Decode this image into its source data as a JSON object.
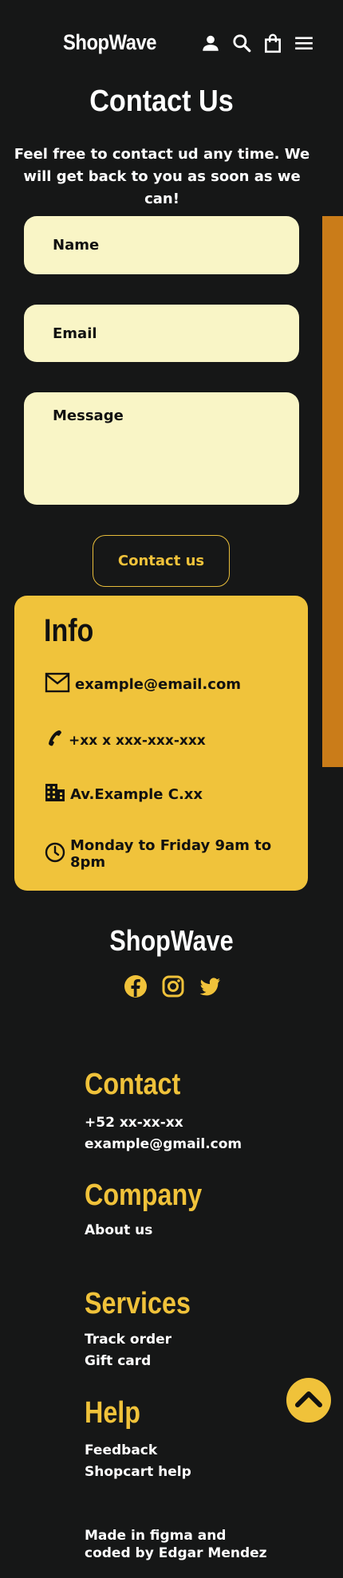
{
  "header": {
    "logo": "ShopWave",
    "icons": [
      "user-icon",
      "search-icon",
      "bag-icon",
      "menu-icon"
    ]
  },
  "page": {
    "title": "Contact Us",
    "intro": "Feel free to contact ud any time. We will get back to you as soon as we can!"
  },
  "form": {
    "name_placeholder": "Name",
    "email_placeholder": "Email",
    "message_placeholder": "Message",
    "submit_label": "Contact us"
  },
  "info": {
    "title": "Info",
    "email": "example@email.com",
    "phone": "+xx x xxx-xxx-xxx",
    "address": "Av.Example C.xx",
    "hours": "Monday to Friday 9am to 8pm"
  },
  "footer": {
    "logo": "ShopWave",
    "social": [
      "facebook-icon",
      "instagram-icon",
      "twitter-icon"
    ],
    "contact": {
      "title": "Contact",
      "phone": "+52 xx-xx-xx",
      "email": "example@gmail.com"
    },
    "company": {
      "title": "Company",
      "about": "About us"
    },
    "services": {
      "title": "Services",
      "track": "Track order",
      "gift": "Gift card"
    },
    "help": {
      "title": "Help",
      "feedback": "Feedback",
      "shopcart": "Shopcart help"
    },
    "credit_line1": "Made in figma and",
    "credit_line2": "coded by Edgar Mendez"
  },
  "colors": {
    "background": "#161717",
    "accent": "#f0c33b",
    "field": "#f9f5c6",
    "stripe": "#ca7c19"
  }
}
